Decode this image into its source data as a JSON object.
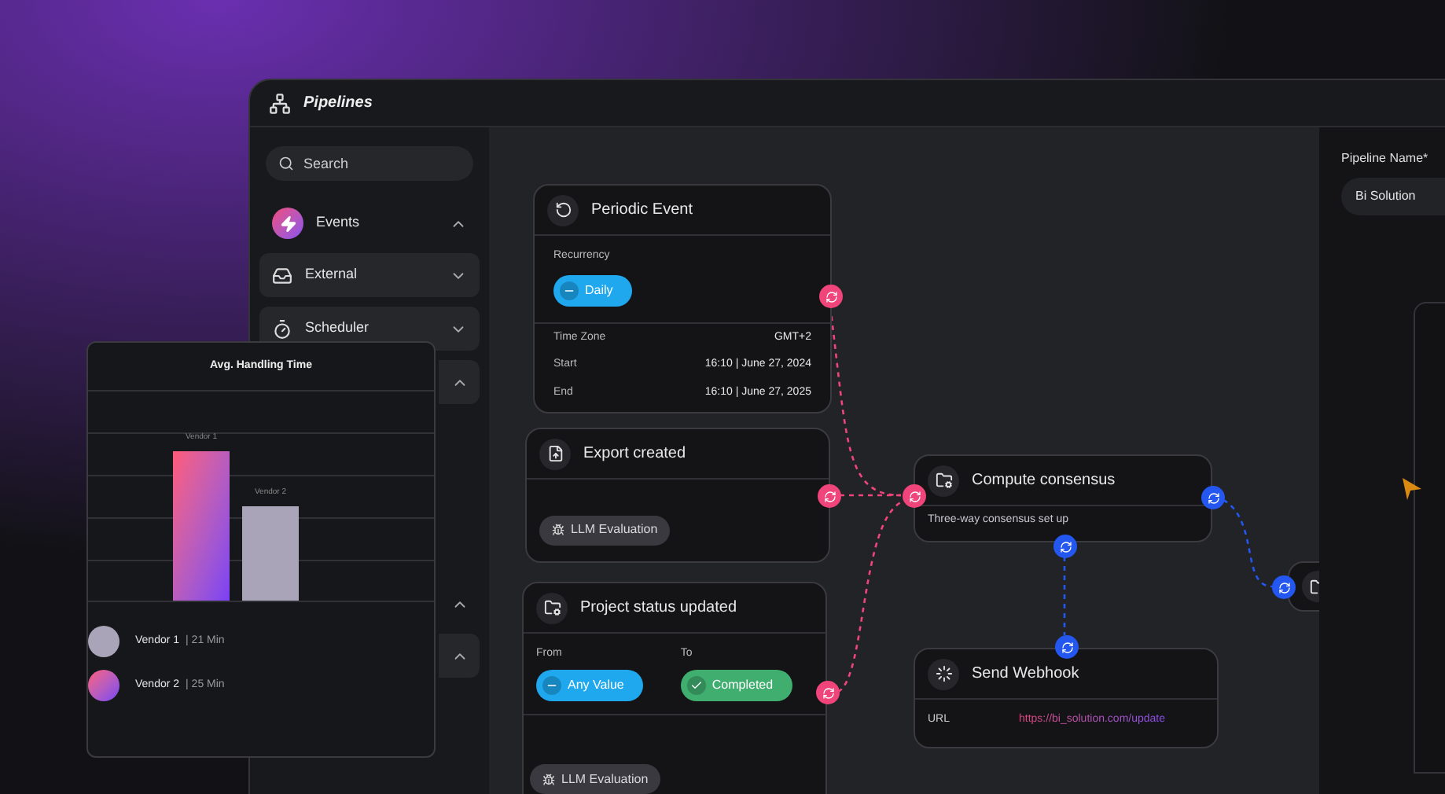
{
  "window": {
    "title": "Pipelines"
  },
  "sidebar": {
    "search": {
      "placeholder": "Search"
    },
    "items": [
      {
        "kind": "section",
        "label": "Events",
        "expanded": true
      },
      {
        "kind": "external",
        "label": "External",
        "expanded": false
      },
      {
        "kind": "scheduler",
        "label": "Scheduler",
        "expanded": false
      },
      {
        "kind": "group",
        "expanded": true
      },
      {
        "kind": "section",
        "expanded": true
      },
      {
        "kind": "group",
        "expanded": true
      }
    ]
  },
  "nodes": [
    {
      "kind": "periodic",
      "title": "Periodic Event",
      "recurrency_label": "Recurrency",
      "recurrency": "Daily",
      "rows": [
        {
          "label": "Time Zone",
          "value": "GMT+2"
        },
        {
          "label": "Start",
          "value": "16:10 | June 27, 2024"
        },
        {
          "label": "End",
          "value": "16:10 | June 27, 2025"
        }
      ]
    },
    {
      "kind": "export",
      "title": "Export created",
      "tag": "LLM Evaluation"
    },
    {
      "kind": "status",
      "title": "Project status updated",
      "from_label": "From",
      "from": "Any Value",
      "to_label": "To",
      "to": "Completed",
      "tag": "LLM Evaluation"
    },
    {
      "kind": "compute",
      "title": "Compute consensus",
      "description": "Three-way consensus set up"
    },
    {
      "kind": "webhook",
      "title": "Send Webhook",
      "url_label": "URL",
      "url": "https://bi_solution.com/update"
    },
    {
      "kind": "partial"
    }
  ],
  "ports": [
    {
      "color": "#f0457a"
    },
    {
      "color": "#f0457a"
    },
    {
      "color": "#f0457a"
    },
    {
      "color": "#f0457a"
    },
    {
      "color": "#2457f0"
    },
    {
      "color": "#2457f0"
    },
    {
      "color": "#2457f0"
    },
    {
      "color": "#2457f0"
    }
  ],
  "settings": {
    "label": "Pipeline Name*",
    "value": "Bi Solution"
  },
  "chart_card": {
    "title": "Avg. Handling Time",
    "bars": [
      {
        "label": "Vendor 1",
        "kind": "gradient"
      },
      {
        "label": "Vendor 2",
        "kind": "solid"
      }
    ],
    "legend": [
      {
        "label": "Vendor 1",
        "value": "| 21 Min",
        "kind": "solid"
      },
      {
        "label": "Vendor 2",
        "value": "| 25 Min",
        "kind": "gradient"
      }
    ]
  }
}
